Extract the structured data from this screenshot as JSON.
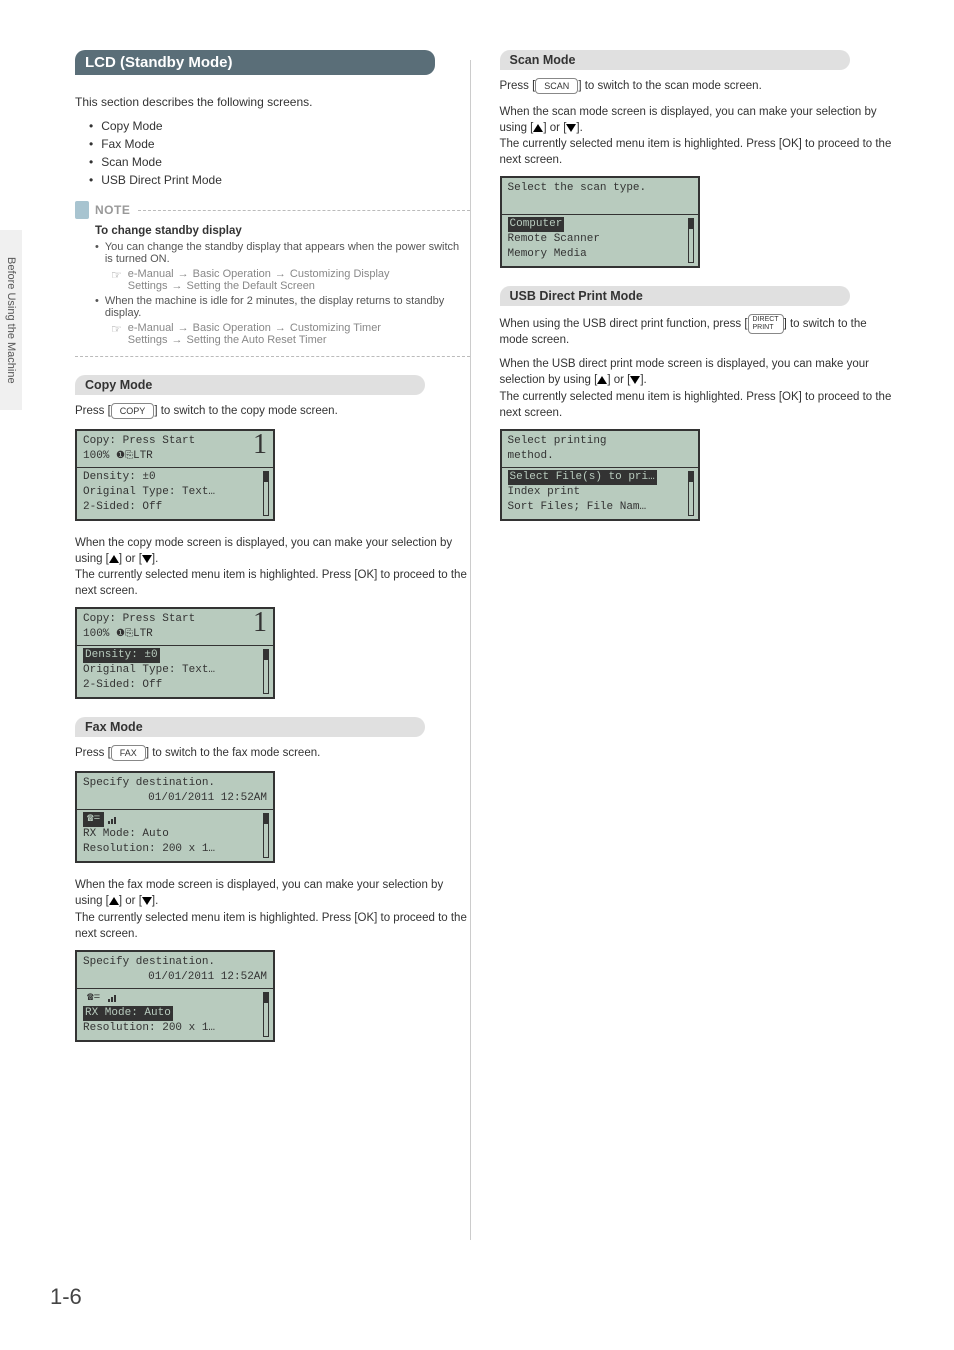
{
  "side_tab": "Before Using the Machine",
  "page_number": "1-6",
  "title": "LCD (Standby Mode)",
  "intro": "This section describes the following screens.",
  "screens_list": [
    "Copy Mode",
    "Fax Mode",
    "Scan Mode",
    "USB Direct Print Mode"
  ],
  "note": {
    "label": "NOTE",
    "heading": "To change standby display",
    "item1": "You can change the standby display that appears when the power switch is turned ON.",
    "ref1": [
      "e-Manual",
      "Basic Operation",
      "Customizing Display Settings",
      "Setting the Default Screen"
    ],
    "item2": "When the machine is idle for 2 minutes, the display returns to standby display.",
    "ref2": [
      "e-Manual",
      "Basic Operation",
      "Customizing Timer Settings",
      "Setting the Auto Reset Timer"
    ]
  },
  "copy": {
    "title": "Copy Mode",
    "press_pre": "Press [",
    "key": "COPY",
    "press_post": "] to switch to the copy mode screen.",
    "lcd1": {
      "top1": "Copy: Press Start",
      "top2_pct": "100%",
      "top2_size": "LTR",
      "big": "1",
      "r1": "Density: ±0",
      "r2": "Original Type: Text…",
      "r3": "2-Sided: Off"
    },
    "desc1": "When the copy mode screen is displayed, you can make your selection by using [",
    "desc2": "] or [",
    "desc3": "].",
    "desc4": "The currently selected menu item is highlighted. Press [OK] to proceed to the next screen.",
    "lcd2_hl": "Density: ±0"
  },
  "fax": {
    "title": "Fax Mode",
    "press_pre": "Press [",
    "key": "FAX",
    "press_post": "] to switch to the fax mode screen.",
    "lcd1": {
      "top1": "Specify destination.",
      "top2": "01/01/2011 12:52AM",
      "r1_hl_icon": true,
      "r2": "RX Mode: Auto",
      "r3": "Resolution: 200 x 1…"
    },
    "desc1": "When the fax mode screen is displayed, you can make your selection by using [",
    "desc2": "] or [",
    "desc3": "].",
    "desc4": "The currently selected menu item is highlighted. Press [OK] to proceed to the next screen.",
    "lcd2_hl": "RX Mode: Auto"
  },
  "scan": {
    "title": "Scan Mode",
    "press_pre": "Press [",
    "key": "SCAN",
    "press_post": "] to switch to the scan mode screen.",
    "desc1": "When the scan mode screen is displayed, you can make your selection by using [",
    "desc2": "] or [",
    "desc3": "].",
    "desc4": "The currently selected menu item is highlighted. Press [OK] to proceed to the next screen.",
    "lcd": {
      "top1": "Select the scan type.",
      "r1_hl": "Computer",
      "r2": "Remote Scanner",
      "r3": "Memory Media"
    }
  },
  "usb": {
    "title": "USB Direct Print Mode",
    "press_pre": "When using the USB direct print function, press [",
    "key": "DIRECT PRINT",
    "press_post": "] to switch to the mode screen.",
    "desc1": "When the USB direct print mode screen is displayed, you can make your selection by using [",
    "desc2": "] or [",
    "desc3": "].",
    "desc4": "The currently selected menu item is highlighted. Press [OK] to proceed to the next screen.",
    "lcd": {
      "top1": "Select printing",
      "top2": "method.",
      "r1_hl": "Select File(s) to pri…",
      "r2": "Index print",
      "r3": "Sort Files; File Nam…"
    }
  }
}
